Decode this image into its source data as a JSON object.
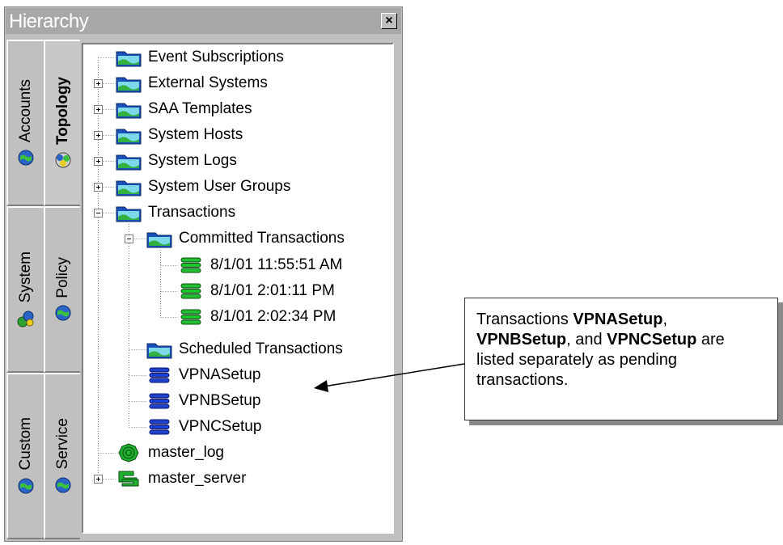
{
  "panel": {
    "title": "Hierarchy",
    "close_glyph": "×"
  },
  "tabs": [
    {
      "label": "Accounts",
      "icon": "globe-icon",
      "active": false
    },
    {
      "label": "Topology",
      "icon": "topology-icon",
      "active": true
    },
    {
      "label": "System",
      "icon": "system-icon",
      "active": false
    },
    {
      "label": "Policy",
      "icon": "globe-icon",
      "active": false
    },
    {
      "label": "Custom",
      "icon": "globe-icon",
      "active": false
    },
    {
      "label": "Service",
      "icon": "globe-icon",
      "active": false
    }
  ],
  "tree": {
    "nodes": [
      {
        "label": "Event Subscriptions",
        "icon": "folder-icon",
        "expander": "none"
      },
      {
        "label": "External Systems",
        "icon": "folder-icon",
        "expander": "plus"
      },
      {
        "label": "SAA Templates",
        "icon": "folder-icon",
        "expander": "plus"
      },
      {
        "label": "System Hosts",
        "icon": "folder-icon",
        "expander": "plus"
      },
      {
        "label": "System Logs",
        "icon": "folder-icon",
        "expander": "plus"
      },
      {
        "label": "System User Groups",
        "icon": "folder-icon",
        "expander": "plus"
      },
      {
        "label": "Transactions",
        "icon": "folder-icon",
        "expander": "minus"
      },
      {
        "label": "Committed Transactions",
        "icon": "folder-icon",
        "expander": "minus"
      },
      {
        "label": "8/1/01 11:55:51 AM",
        "icon": "committed-transaction-icon",
        "expander": "none"
      },
      {
        "label": "8/1/01 2:01:11 PM",
        "icon": "committed-transaction-icon",
        "expander": "none"
      },
      {
        "label": "8/1/01 2:02:34 PM",
        "icon": "committed-transaction-icon",
        "expander": "none"
      },
      {
        "label": "Scheduled Transactions",
        "icon": "folder-icon",
        "expander": "none"
      },
      {
        "label": "VPNASetup",
        "icon": "pending-transaction-icon",
        "expander": "none"
      },
      {
        "label": "VPNBSetup",
        "icon": "pending-transaction-icon",
        "expander": "none"
      },
      {
        "label": "VPNCSetup",
        "icon": "pending-transaction-icon",
        "expander": "none"
      },
      {
        "label": "master_log",
        "icon": "log-icon",
        "expander": "none"
      },
      {
        "label": "master_server",
        "icon": "server-icon",
        "expander": "plus"
      }
    ]
  },
  "callout": {
    "t1": "Transactions ",
    "b1": "VPNASetup",
    "t2": ", ",
    "b2": "VPNBSetup",
    "t3": ", and ",
    "b3": "VPNCSetup",
    "t4": " are listed separately as pending transactions."
  }
}
